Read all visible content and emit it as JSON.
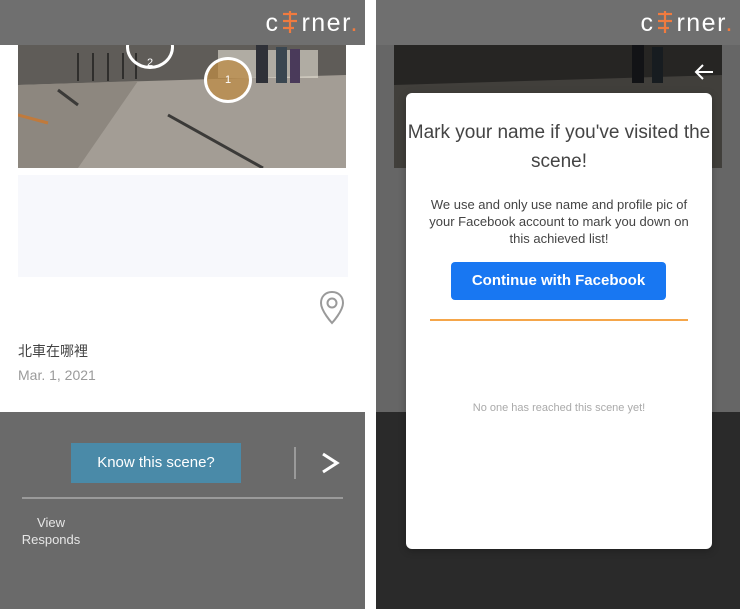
{
  "brand": {
    "logo_prefix": "c",
    "logo_suffix": "rner",
    "logo_dot": ".",
    "accent_color": "#f07b3f"
  },
  "scene": {
    "markers": [
      "2",
      "1"
    ],
    "name": "北車在哪裡",
    "date": "Mar. 1, 2021",
    "location_icon": "location-pin-icon"
  },
  "actions": {
    "know_button": "Know this scene?",
    "next_icon": "chevron-right-icon",
    "view_responds": "View Responds",
    "button_color": "#4a8aa8"
  },
  "modal": {
    "back_icon": "arrow-left-icon",
    "title": "Mark your name if you've visited the scene!",
    "description": "We use and only use name and profile pic of your Facebook account to mark you down on this achieved list!",
    "facebook_button": "Continue with Facebook",
    "facebook_color": "#1877f2",
    "divider_color": "#f5a64a",
    "empty_message": "No one has reached this scene yet!"
  }
}
